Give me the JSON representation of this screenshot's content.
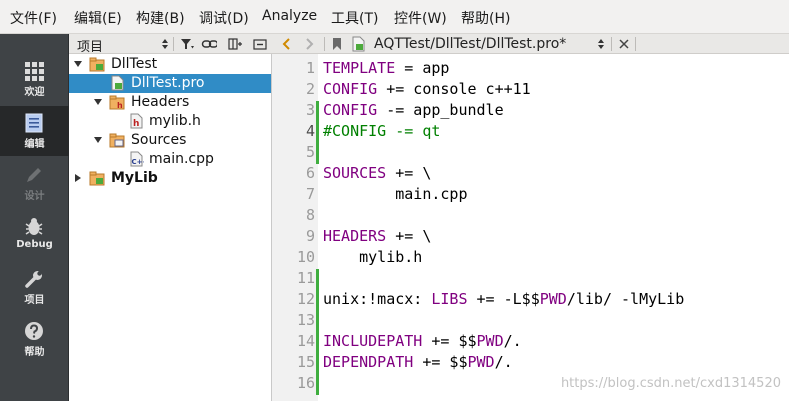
{
  "menu": [
    "文件(F)",
    "编辑(E)",
    "构建(B)",
    "调试(D)",
    "Analyze",
    "工具(T)",
    "控件(W)",
    "帮助(H)"
  ],
  "modes": [
    {
      "icon": "grid-icon",
      "label": "欢迎"
    },
    {
      "icon": "document-icon",
      "label": "编辑"
    },
    {
      "icon": "pencil-icon",
      "label": "设计"
    },
    {
      "icon": "bug-icon",
      "label": "Debug"
    },
    {
      "icon": "wrench-icon",
      "label": "项目"
    },
    {
      "icon": "help-icon",
      "label": "帮助"
    }
  ],
  "project_pane": {
    "title": "项目",
    "tree": [
      {
        "label": "DllTest",
        "expanded": true
      },
      {
        "label": "DllTest.pro",
        "selected": true
      },
      {
        "label": "Headers",
        "expanded": true
      },
      {
        "label": "mylib.h"
      },
      {
        "label": "Sources",
        "expanded": true
      },
      {
        "label": "main.cpp"
      },
      {
        "label": "MyLib",
        "expanded": false,
        "bold": true
      }
    ]
  },
  "editor": {
    "file_path": "AQTTest/DllTest/DllTest.pro*",
    "current_line": 4,
    "lines": [
      "TEMPLATE = app",
      "CONFIG += console c++11",
      "CONFIG -= app_bundle",
      "#CONFIG -= qt",
      "",
      "SOURCES += \\",
      "        main.cpp",
      "",
      "HEADERS += \\",
      "    mylib.h",
      "",
      "unix:!macx: LIBS += -L$$PWD/lib/ -lMyLib",
      "",
      "INCLUDEPATH += $$PWD/.",
      "DEPENDPATH += $$PWD/.",
      ""
    ]
  },
  "watermark": "https://blog.csdn.net/cxd1314520",
  "colors": {
    "keyword": "#800080",
    "comment": "#008000",
    "selection": "#308cc6",
    "modebar": "#3f4346"
  }
}
